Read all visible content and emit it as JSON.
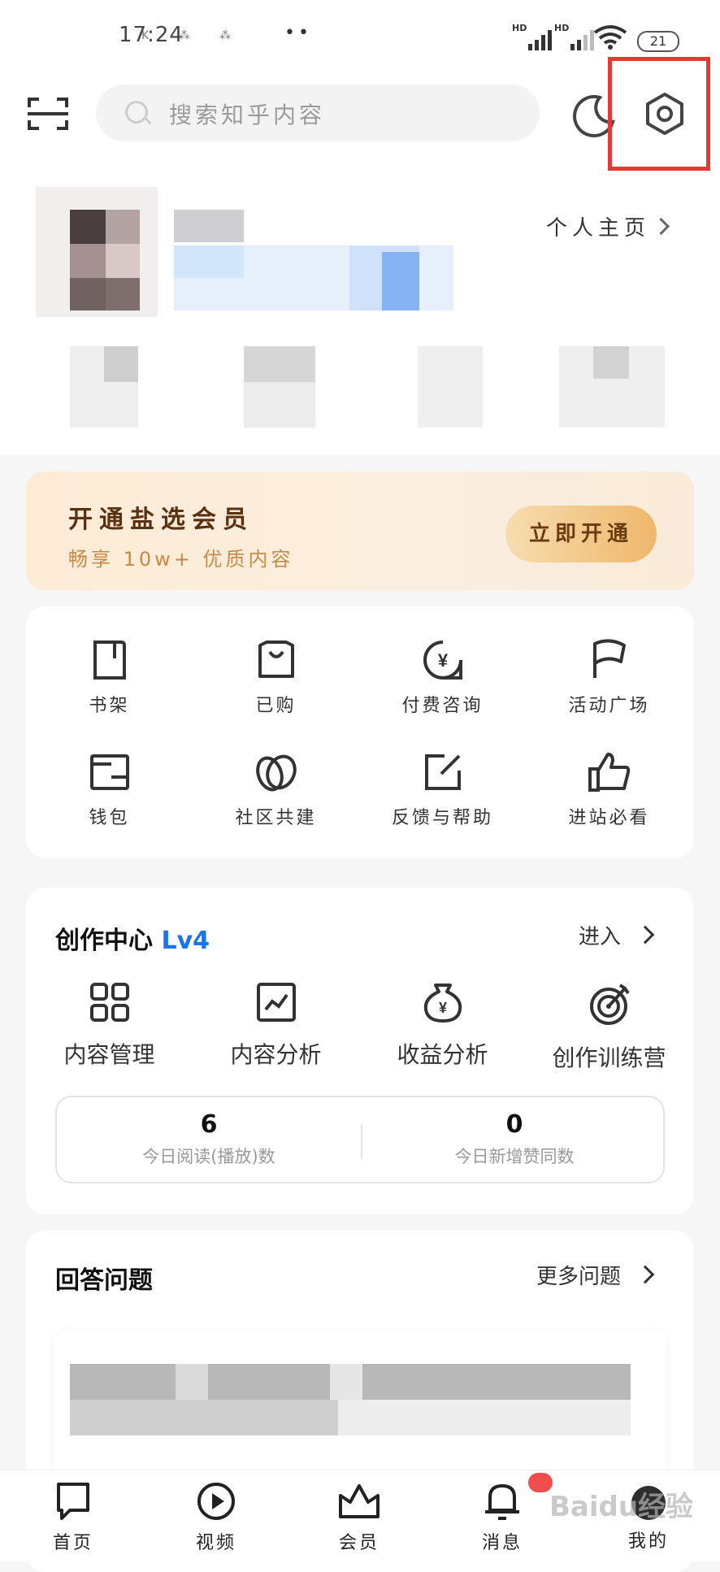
{
  "status_bar": {
    "time": "17:24",
    "indicators": "K ⁂ ⁂",
    "dots": "••",
    "signal_1_label": "HD",
    "signal_2_label": "HD",
    "battery": "21"
  },
  "header": {
    "search_placeholder": "搜索知乎内容",
    "icons": [
      "scan-icon",
      "search-icon",
      "night-mode-icon",
      "settings-gear-icon"
    ]
  },
  "profile": {
    "home_link": "个人主页"
  },
  "vip": {
    "title": "开通盐选会员",
    "subtitle": "畅享 10w+ 优质内容",
    "button": "立即开通"
  },
  "quick_grid": [
    {
      "label": "书架",
      "icon": "bookshelf-icon"
    },
    {
      "label": "已购",
      "icon": "shopping-bag-icon"
    },
    {
      "label": "付费咨询",
      "icon": "paid-consult-icon"
    },
    {
      "label": "活动广场",
      "icon": "flag-icon"
    },
    {
      "label": "钱包",
      "icon": "wallet-icon"
    },
    {
      "label": "社区共建",
      "icon": "community-icon"
    },
    {
      "label": "反馈与帮助",
      "icon": "feedback-icon"
    },
    {
      "label": "进站必看",
      "icon": "thumbs-up-icon"
    }
  ],
  "creation_center": {
    "title": "创作中心",
    "level": "Lv4",
    "enter": "进入",
    "items": [
      {
        "label": "内容管理",
        "icon": "grid-icon"
      },
      {
        "label": "内容分析",
        "icon": "chart-icon"
      },
      {
        "label": "收益分析",
        "icon": "money-bag-icon"
      },
      {
        "label": "创作训练营",
        "icon": "target-icon"
      }
    ],
    "stats": [
      {
        "value": "6",
        "caption": "今日阅读(播放)数"
      },
      {
        "value": "0",
        "caption": "今日新增赞同数"
      }
    ]
  },
  "answer": {
    "title": "回答问题",
    "more": "更多问题"
  },
  "bottom_nav": [
    {
      "label": "首页",
      "icon": "home-icon"
    },
    {
      "label": "视频",
      "icon": "video-icon"
    },
    {
      "label": "会员",
      "icon": "crown-icon"
    },
    {
      "label": "消息",
      "icon": "bell-icon"
    },
    {
      "label": "我的",
      "icon": "avatar-icon"
    }
  ],
  "watermark": "Baidu经验",
  "colors": {
    "accent_blue": "#1a73e8",
    "highlight_red": "#e53935",
    "vip_brown": "#5a3211",
    "vip_gold": "#efb76b"
  }
}
